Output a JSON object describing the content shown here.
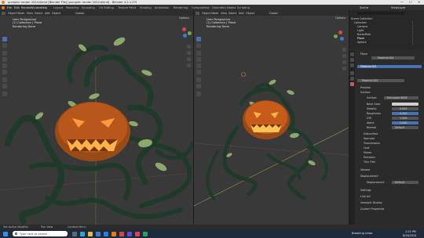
{
  "window": {
    "title": "pumpkin render 2024.blend [Blender File] [pumpkin render 2024.blend] - Blender 4.2.1 LTS",
    "controls": [
      "—",
      "☐",
      "✕"
    ]
  },
  "menubar": {
    "items": [
      "File",
      "Edit",
      "Render",
      "Window",
      "Help"
    ],
    "workspaces": [
      "Layout",
      "Modeling",
      "Sculpting",
      "UV Editing",
      "Texture Paint",
      "Shading",
      "Animation",
      "Rendering",
      "Compositing",
      "Geometry Nodes",
      "Scripting"
    ],
    "scene_label": "Scene",
    "viewlayer_label": "ViewLayer"
  },
  "viewport_left": {
    "mode": "Object Mode",
    "menus": [
      "View",
      "Select",
      "Add",
      "Object"
    ],
    "transform": "Global",
    "options": "Options",
    "overlay": [
      "User Perspective",
      "(1) Collection | Plane",
      "Rendering Done"
    ]
  },
  "viewport_right": {
    "mode": "Object Mode",
    "menus": [
      "View",
      "Select",
      "Add",
      "Object"
    ],
    "transform": "Global",
    "options": "Options",
    "overlay": [
      "User Perspective",
      "(1) Collection | Plane",
      "Rendering Done"
    ]
  },
  "outliner": {
    "title": "Scene Collection",
    "items": [
      "Collection",
      "Camera",
      "Light",
      "NurbsPath",
      "Plane",
      "Sphere"
    ]
  },
  "properties": {
    "object": "Plane",
    "material": "Material.001",
    "slot": "Material.001",
    "sections": {
      "preview": "Preview",
      "surface_header": "Surface",
      "surface": "Surface",
      "surface_value": "Principled BSDF",
      "base_color": "Base Color",
      "metallic": "Metallic",
      "metallic_value": "0.000",
      "roughness": "Roughness",
      "roughness_value": "0.500",
      "ior": "IOR",
      "ior_value": "1.500",
      "alpha": "Alpha",
      "alpha_value": "1.000",
      "normal": "Normal",
      "normal_value": "Default",
      "subsurface": "Subsurface",
      "specular": "Specular",
      "transmission": "Transmission",
      "coat": "Coat",
      "sheen": "Sheen",
      "emission": "Emission",
      "thin_film": "Thin Film",
      "volume": "Volume",
      "displacement_header": "Displacement",
      "displacement": "Displacement",
      "displacement_value": "Default",
      "settings": "Settings",
      "line_art": "Line Art",
      "viewport_display": "Viewport Display",
      "custom_properties": "Custom Properties"
    }
  },
  "statusbar": {
    "left": "Set Active Modifier",
    "mid": "Pan View",
    "right": "Context Menu"
  },
  "taskbar": {
    "search_placeholder": "Type here to search",
    "news": "Breaking news",
    "time": "1:15 PM",
    "date": "8/18/2024"
  },
  "colors": {
    "accent": "#4772b3",
    "pumpkin": "#c75b1a",
    "vine": "#1f3a29",
    "leaf": "#8aa96a"
  }
}
